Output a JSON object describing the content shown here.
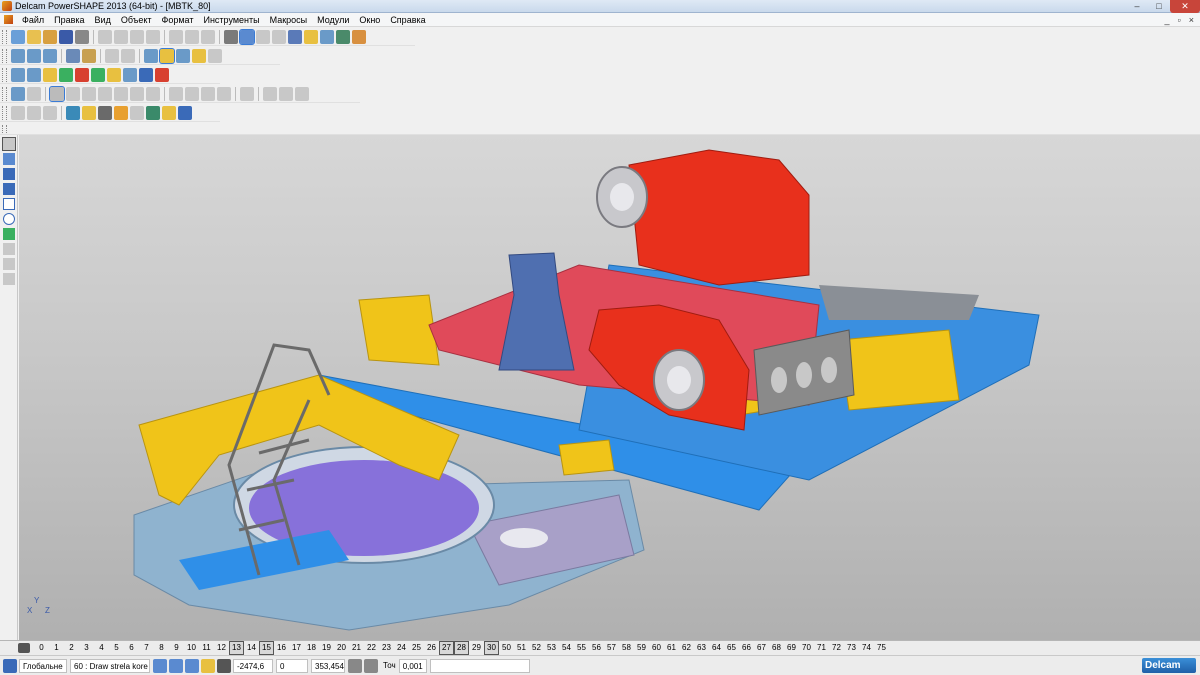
{
  "window": {
    "title": "Delcam PowerSHAPE 2013 (64-bit) - [MBTK_80]",
    "controls": [
      "–",
      "□",
      "✕"
    ]
  },
  "menu": {
    "items": [
      "Файл",
      "Правка",
      "Вид",
      "Объект",
      "Формат",
      "Инструменты",
      "Макросы",
      "Модули",
      "Окно",
      "Справка"
    ],
    "mdi_controls": [
      "_",
      "▫",
      "×"
    ]
  },
  "levels": {
    "numbers": [
      "0",
      "1",
      "2",
      "3",
      "4",
      "5",
      "6",
      "7",
      "8",
      "9",
      "10",
      "11",
      "12",
      "13",
      "14",
      "15",
      "16",
      "17",
      "18",
      "19",
      "20",
      "21",
      "22",
      "23",
      "24",
      "25",
      "26",
      "27",
      "28",
      "29",
      "30",
      "50",
      "51",
      "52",
      "53",
      "54",
      "55",
      "56",
      "57",
      "58",
      "59",
      "60",
      "61",
      "62",
      "63",
      "64",
      "65",
      "66",
      "67",
      "68",
      "69",
      "70",
      "71",
      "72",
      "73",
      "74",
      "75"
    ],
    "active": [
      "13",
      "15",
      "27",
      "28",
      "30"
    ]
  },
  "status": {
    "workplane": "Глобальне",
    "level_name": "60 : Draw strela kore",
    "x": "-2474,6",
    "y": "0",
    "z": "353,454",
    "tolerance_label": "Точ",
    "tolerance": "0,001",
    "brand": "Delcam"
  },
  "axis": {
    "x": "X",
    "y": "Y",
    "z": "Z"
  },
  "colors": {
    "gearbox": "#e8301c",
    "frame_yellow": "#f0c419",
    "platform_blue": "#2f8fe8",
    "base_grey_blue": "#8fb3cf",
    "carriage_pink": "#e04a5a",
    "bearing_blue": "#4f6fb0",
    "ring_purple": "#7a5fd8"
  }
}
